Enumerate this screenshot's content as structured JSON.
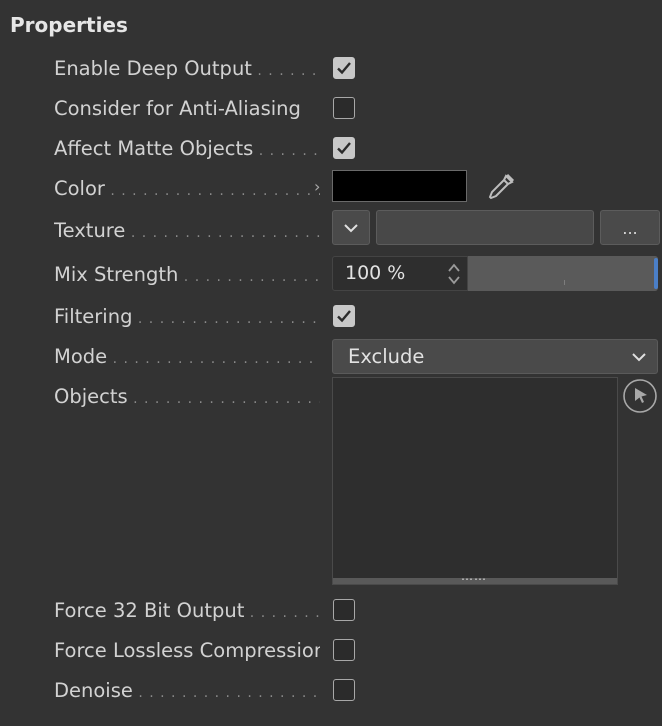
{
  "panel": {
    "title": "Properties"
  },
  "rows": {
    "enable_deep_output": {
      "label": "Enable Deep Output",
      "checked": true
    },
    "consider_anti_aliasing": {
      "label": "Consider for Anti-Aliasing",
      "checked": false
    },
    "affect_matte_objects": {
      "label": "Affect Matte Objects",
      "checked": true
    },
    "color": {
      "label": "Color",
      "value": "#000000"
    },
    "texture": {
      "label": "Texture",
      "browse_label": "..."
    },
    "mix_strength": {
      "label": "Mix Strength",
      "value": "100 %",
      "level_percent": 100
    },
    "filtering": {
      "label": "Filtering",
      "checked": true
    },
    "mode": {
      "label": "Mode",
      "value": "Exclude"
    },
    "objects": {
      "label": "Objects",
      "items": []
    },
    "force_32_bit": {
      "label": "Force 32 Bit Output",
      "checked": false
    },
    "force_lossless": {
      "label": "Force Lossless Compression",
      "checked": false
    },
    "denoise": {
      "label": "Denoise",
      "checked": false
    }
  },
  "icons": {
    "checkmark": "checkmark-icon",
    "eyedropper": "eyedropper-icon",
    "chevron_down": "chevron-down-icon",
    "pick_cursor": "cursor-pick-icon",
    "expand": "chevron-right-icon"
  },
  "colors": {
    "background": "#333333",
    "accent": "#4b7fc7"
  }
}
